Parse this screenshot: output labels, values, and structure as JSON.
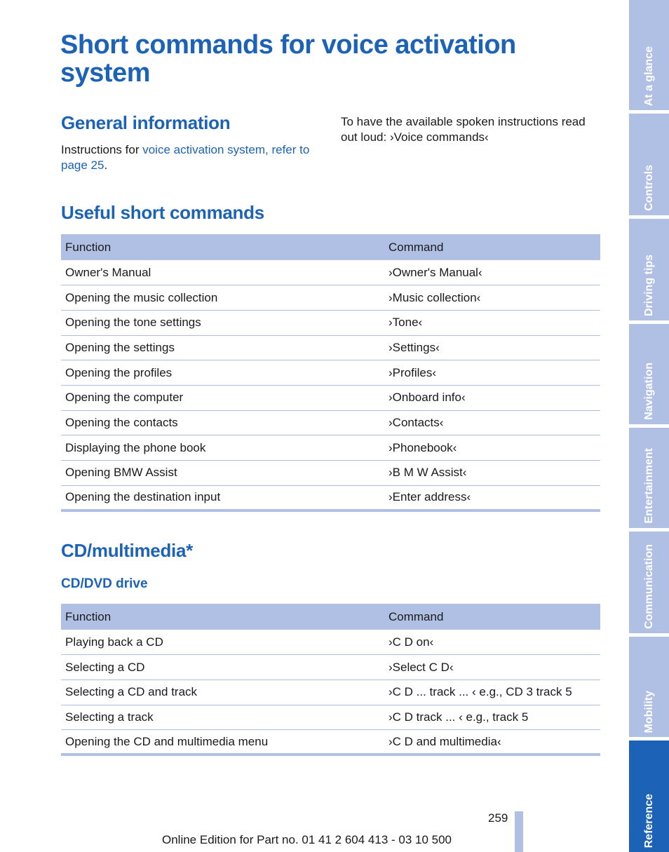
{
  "title": "Short commands for voice activation system",
  "general": {
    "heading": "General information",
    "intro_prefix": "Instructions for ",
    "intro_link": "voice activation system, refer to page 25",
    "intro_suffix": ".",
    "right_text": "To have the available spoken instructions read out loud: ›Voice commands‹"
  },
  "useful": {
    "heading": "Useful short commands",
    "columns": [
      "Function",
      "Command"
    ],
    "rows": [
      [
        "Owner's Manual",
        "›Owner's Manual‹"
      ],
      [
        "Opening the music collection",
        "›Music collection‹"
      ],
      [
        "Opening the tone settings",
        "›Tone‹"
      ],
      [
        "Opening the settings",
        "›Settings‹"
      ],
      [
        "Opening the profiles",
        "›Profiles‹"
      ],
      [
        "Opening the computer",
        "›Onboard info‹"
      ],
      [
        "Opening the contacts",
        "›Contacts‹"
      ],
      [
        "Displaying the phone book",
        "›Phonebook‹"
      ],
      [
        "Opening BMW Assist",
        "›B M W Assist‹"
      ],
      [
        "Opening the destination input",
        "›Enter address‹"
      ]
    ]
  },
  "cd": {
    "heading": "CD/multimedia*",
    "subheading": "CD/DVD drive",
    "columns": [
      "Function",
      "Command"
    ],
    "rows": [
      [
        "Playing back a CD",
        "›C D on‹"
      ],
      [
        "Selecting a CD",
        "›Select C D‹"
      ],
      [
        "Selecting a CD and track",
        "›C D ... track ... ‹ e.g., CD 3 track 5"
      ],
      [
        "Selecting a track",
        "›C D track ... ‹ e.g., track 5"
      ],
      [
        "Opening the CD and multimedia menu",
        "›C D and multimedia‹"
      ]
    ]
  },
  "sidebar": {
    "tabs": [
      {
        "label": "At a glance",
        "active": false
      },
      {
        "label": "Controls",
        "active": false
      },
      {
        "label": "Driving tips",
        "active": false
      },
      {
        "label": "Navigation",
        "active": false
      },
      {
        "label": "Entertainment",
        "active": false
      },
      {
        "label": "Communication",
        "active": false
      },
      {
        "label": "Mobility",
        "active": false
      },
      {
        "label": "Reference",
        "active": true
      }
    ]
  },
  "footer": {
    "page_number": "259",
    "edition": "Online Edition for Part no. 01 41 2 604 413 - 03 10 500"
  },
  "colors": {
    "accent_blue": "#1c63b7",
    "light_blue": "#b0c0e4"
  }
}
